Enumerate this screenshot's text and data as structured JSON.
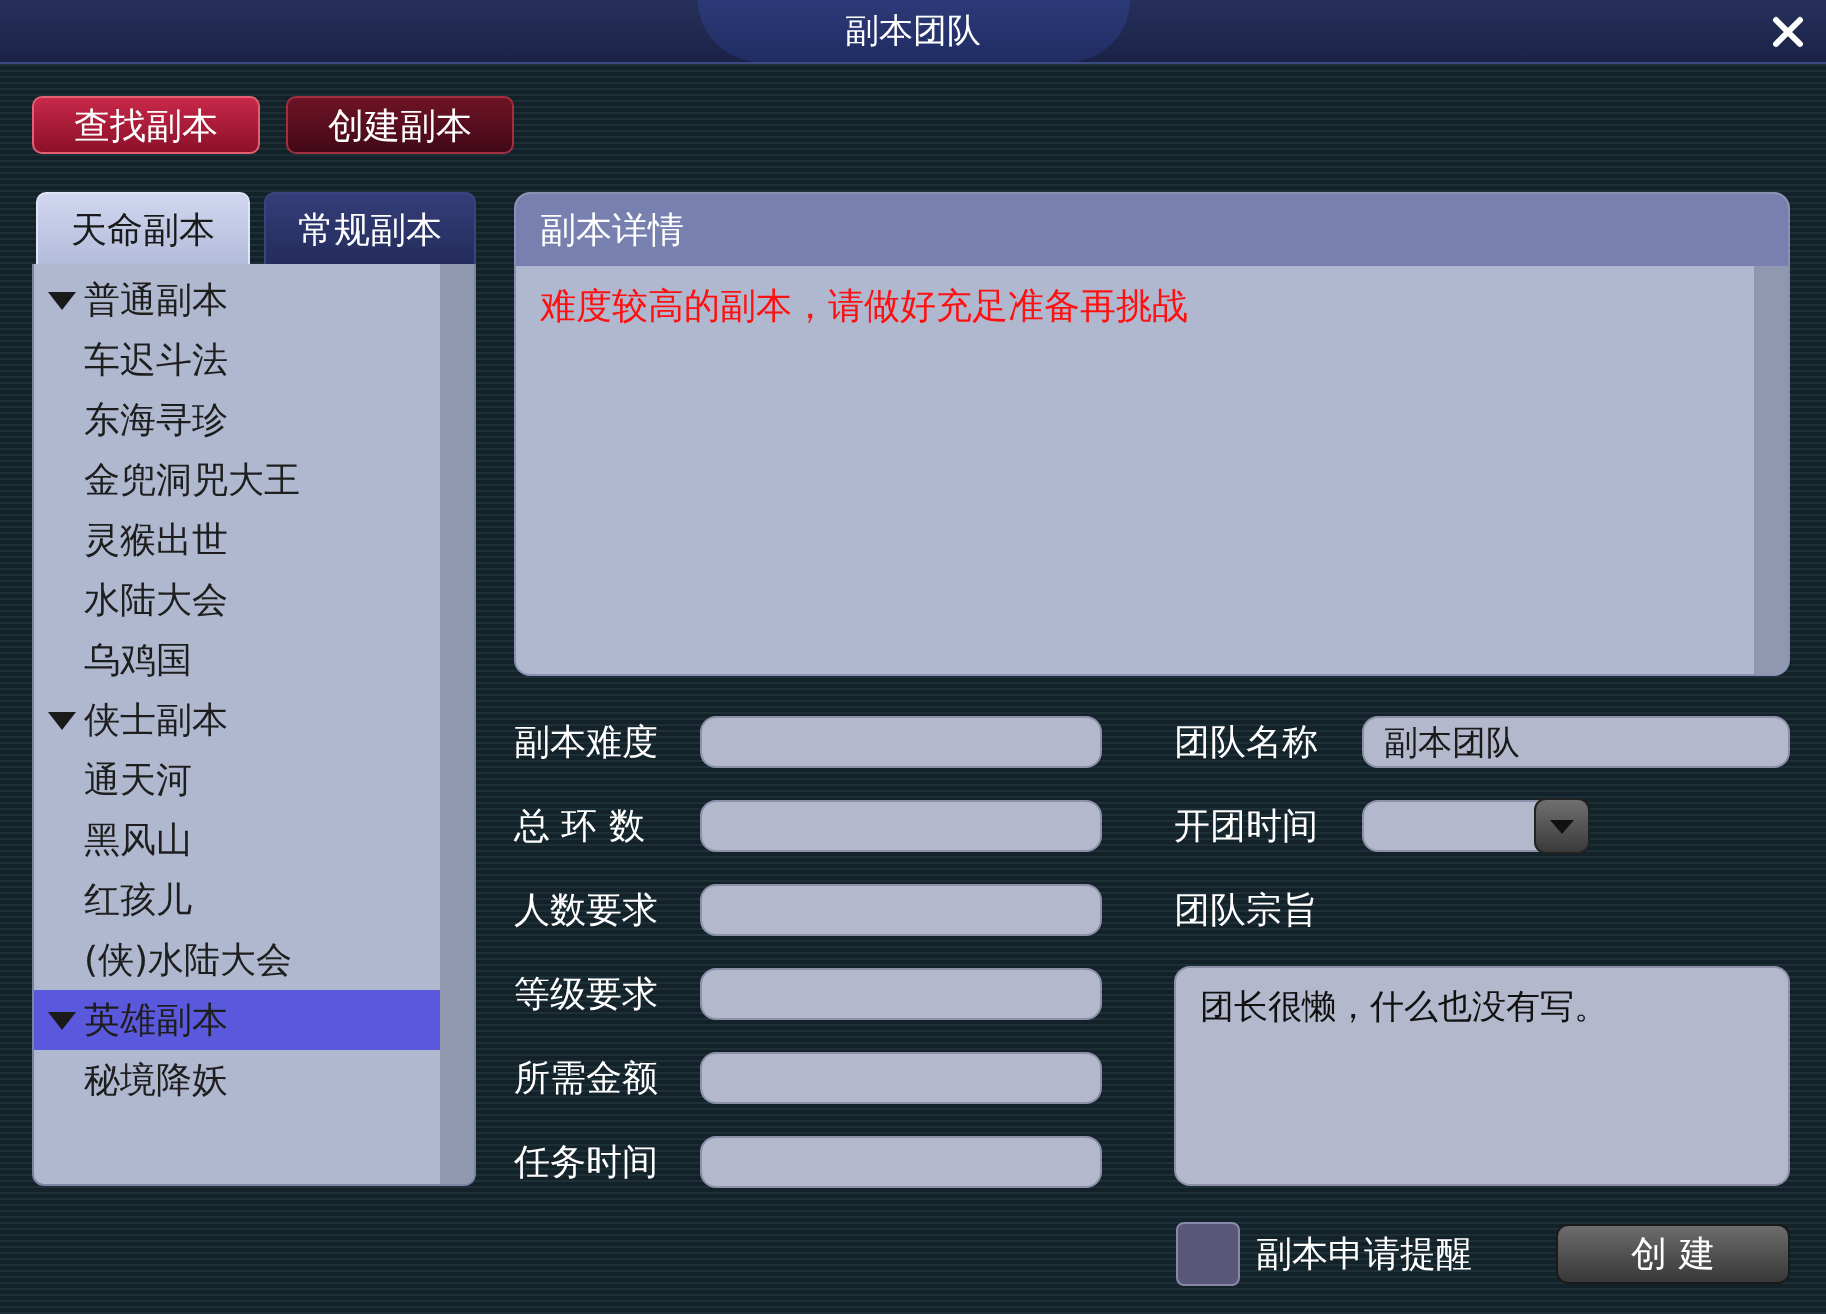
{
  "window": {
    "title": "副本团队"
  },
  "mode_buttons": [
    {
      "label": "查找副本",
      "selected": true
    },
    {
      "label": "创建副本",
      "selected": false
    }
  ],
  "category_tabs": [
    {
      "label": "天命副本",
      "selected": true
    },
    {
      "label": "常规副本",
      "selected": false
    }
  ],
  "dungeon_tree": [
    {
      "label": "普通副本",
      "expanded": true,
      "selected": false,
      "children": [
        {
          "label": "车迟斗法",
          "selected": false
        },
        {
          "label": "东海寻珍",
          "selected": false
        },
        {
          "label": "金兜洞兕大王",
          "selected": false
        },
        {
          "label": "灵猴出世",
          "selected": false
        },
        {
          "label": "水陆大会",
          "selected": false
        },
        {
          "label": "乌鸡国",
          "selected": false
        }
      ]
    },
    {
      "label": "侠士副本",
      "expanded": true,
      "selected": false,
      "children": [
        {
          "label": "通天河",
          "selected": false
        },
        {
          "label": "黑风山",
          "selected": false
        },
        {
          "label": "红孩儿",
          "selected": false
        },
        {
          "label": "(侠)水陆大会",
          "selected": false
        }
      ]
    },
    {
      "label": "英雄副本",
      "expanded": true,
      "selected": true,
      "children": [
        {
          "label": "秘境降妖",
          "selected": false
        }
      ]
    }
  ],
  "details": {
    "title": "副本详情",
    "text": "难度较高的副本，请做好充足准备再挑战"
  },
  "dungeon_fields": [
    {
      "label": "副本难度"
    },
    {
      "label": "总 环 数"
    },
    {
      "label": "人数要求"
    },
    {
      "label": "等级要求"
    },
    {
      "label": "所需金额"
    },
    {
      "label": "任务时间"
    }
  ],
  "team_name": {
    "label": "团队名称",
    "value": "副本团队"
  },
  "start_time": {
    "label": "开团时间"
  },
  "team_purpose": {
    "label": "团队宗旨",
    "value": "团长很懒，什么也没有写。"
  },
  "apply_reminder": {
    "label": "副本申请提醒",
    "checked": false
  },
  "create_button": {
    "label": "创 建"
  }
}
